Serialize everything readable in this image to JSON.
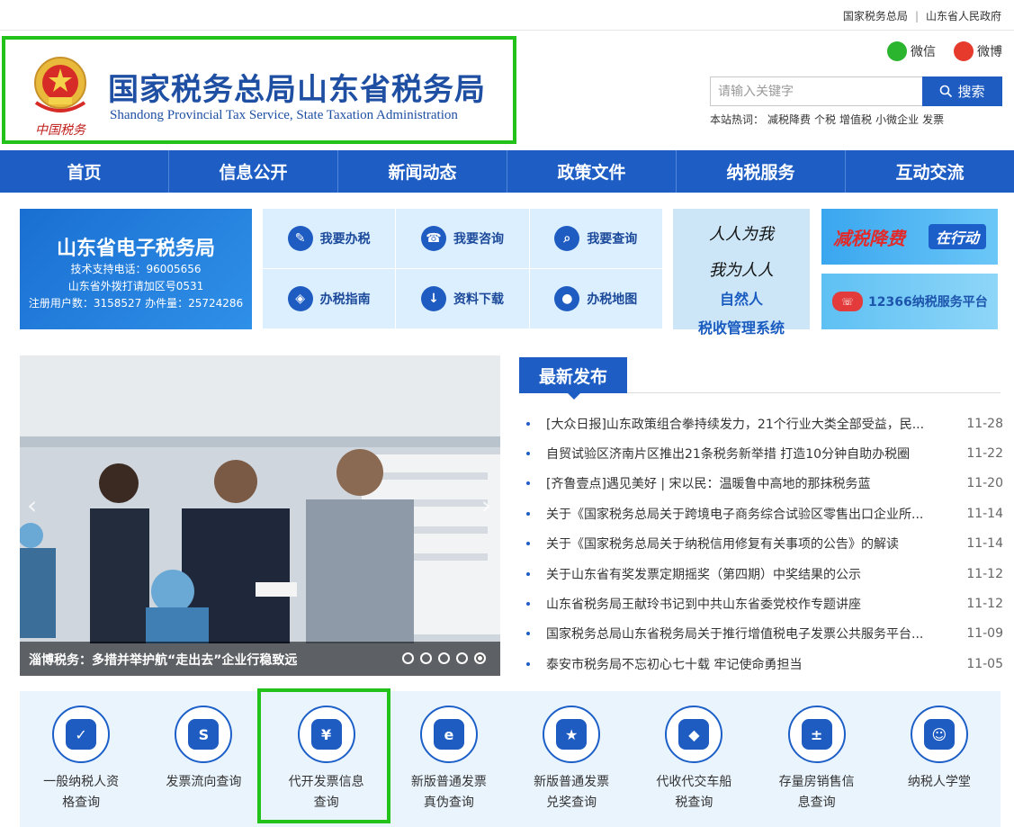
{
  "topbar": {
    "link1": "国家税务总局",
    "sep": "|",
    "link2": "山东省人民政府"
  },
  "header": {
    "title": "国家税务总局山东省税务局",
    "subtitle": "Shandong Provincial Tax Service, State Taxation Administration",
    "emblem_text": "中国税务",
    "wechat": "微信",
    "weibo": "微博",
    "search_placeholder": "请输入关键字",
    "search_button": "搜索",
    "hot_label": "本站热词：",
    "hot_words": [
      "减税降费",
      "个税",
      "增值税",
      "小微企业",
      "发票"
    ]
  },
  "nav": [
    "首页",
    "信息公开",
    "新闻动态",
    "政策文件",
    "纳税服务",
    "互动交流"
  ],
  "etax": {
    "title": "山东省电子税务局",
    "line1": "技术支持电话：96005656",
    "line2": "山东省外拨打请加区号0531",
    "line3": "注册用户数：3158527   办件量：25724286"
  },
  "services": [
    "我要办税",
    "我要咨询",
    "我要查询",
    "办税指南",
    "资料下载",
    "办税地图"
  ],
  "natural": {
    "script1": "人人为我",
    "script2": "我为人人",
    "line1": "自然人",
    "line2": "税收管理系统"
  },
  "banner1": {
    "left": "减税降费",
    "right": "在行动"
  },
  "banner2": {
    "badge": "12366",
    "text": "12366纳税服务平台"
  },
  "slide": {
    "caption": "淄博税务：多措并举护航“走出去”企业行稳致远",
    "active_index": 4,
    "dot_count": 5
  },
  "news": {
    "heading": "最新发布",
    "items": [
      {
        "title": "[大众日报]山东政策组合拳持续发力，21个行业大类全部受益，民...",
        "date": "11-28"
      },
      {
        "title": "自贸试验区济南片区推出21条税务新举措 打造10分钟自助办税圈",
        "date": "11-22"
      },
      {
        "title": "[齐鲁壹点]遇见美好 | 宋以民：温暖鲁中高地的那抹税务蓝",
        "date": "11-20"
      },
      {
        "title": "关于《国家税务总局关于跨境电子商务综合试验区零售出口企业所...",
        "date": "11-14"
      },
      {
        "title": "关于《国家税务总局关于纳税信用修复有关事项的公告》的解读",
        "date": "11-14"
      },
      {
        "title": "关于山东省有奖发票定期摇奖（第四期）中奖结果的公示",
        "date": "11-12"
      },
      {
        "title": "山东省税务局王献玲书记到中共山东省委党校作专题讲座",
        "date": "11-12"
      },
      {
        "title": "国家税务总局山东省税务局关于推行增值税电子发票公共服务平台...",
        "date": "11-09"
      },
      {
        "title": "泰安市税务局不忘初心七十载 牢记使命勇担当",
        "date": "11-05"
      }
    ]
  },
  "quick": [
    {
      "l1": "一般纳税人资",
      "l2": "格查询",
      "icon": "calendar-check"
    },
    {
      "l1": "发票流向查询",
      "l2": "",
      "icon": "sj-logo"
    },
    {
      "l1": "代开发票信息",
      "l2": "查询",
      "icon": "yuan-ticket"
    },
    {
      "l1": "新版普通发票",
      "l2": "真伪查询",
      "icon": "e-monitor"
    },
    {
      "l1": "新版普通发票",
      "l2": "兑奖查询",
      "icon": "award-book"
    },
    {
      "l1": "代收代交车船",
      "l2": "税查询",
      "icon": "diamond"
    },
    {
      "l1": "存量房销售信",
      "l2": "息查询",
      "icon": "calculator"
    },
    {
      "l1": "纳税人学堂",
      "l2": "",
      "icon": "classroom"
    }
  ]
}
